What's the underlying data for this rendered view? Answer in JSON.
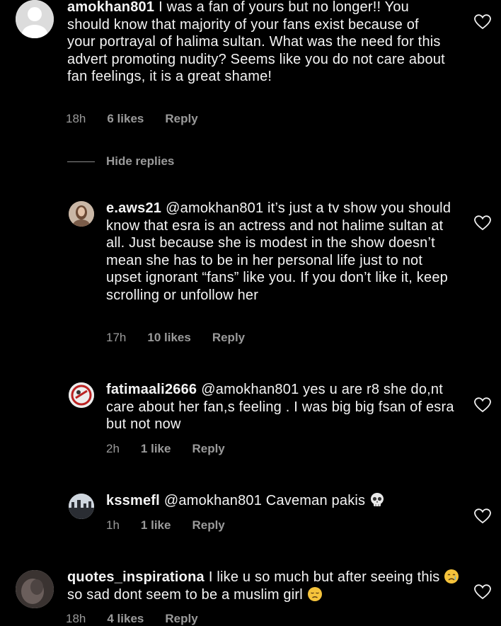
{
  "comments": [
    {
      "username": "amokhan801",
      "text": "I was a fan of yours but no longer!! You should know that majority of your fans exist because of your portrayal of halima sultan. What was the need for this advert promoting nudity? Seems like you do not care about fan feelings, it is a great shame!",
      "time": "18h",
      "likes": "6 likes",
      "reply": "Reply"
    },
    {
      "username": "e.aws21",
      "text": "@amokhan801 it’s just a tv show you should know that esra is an actress and not halime sultan at all. Just because she is modest in the show doesn’t mean she has to be in her personal life just to not upset ignorant “fans” like you. If you don’t like it, keep scrolling or unfollow her",
      "time": "17h",
      "likes": "10 likes",
      "reply": "Reply"
    },
    {
      "username": "fatimaali2666",
      "text": "@amokhan801 yes u are r8 she do,nt care about her fan,s feeling . I was big big fsan of esra but not now",
      "time": "2h",
      "likes": "1 like",
      "reply": "Reply"
    },
    {
      "username": "kssmefl",
      "text": "@amokhan801 Caveman pakis",
      "time": "1h",
      "likes": "1 like",
      "reply": "Reply"
    },
    {
      "username": "quotes_inspirationa",
      "text_a": "I like u so much but after seeing this",
      "text_b": "so sad dont seem to be a muslim girl",
      "time": "18h",
      "likes": "4 likes",
      "reply": "Reply"
    }
  ],
  "hide_replies": "Hide replies",
  "icons": {
    "heart": "heart-outline-icon",
    "skull": "skull-emoji",
    "crying": "crying-face-emoji",
    "disappointed": "disappointed-face-emoji"
  },
  "colors": {
    "background": "#000000",
    "text": "#f2f2f2",
    "meta": "#9a9a9a"
  }
}
